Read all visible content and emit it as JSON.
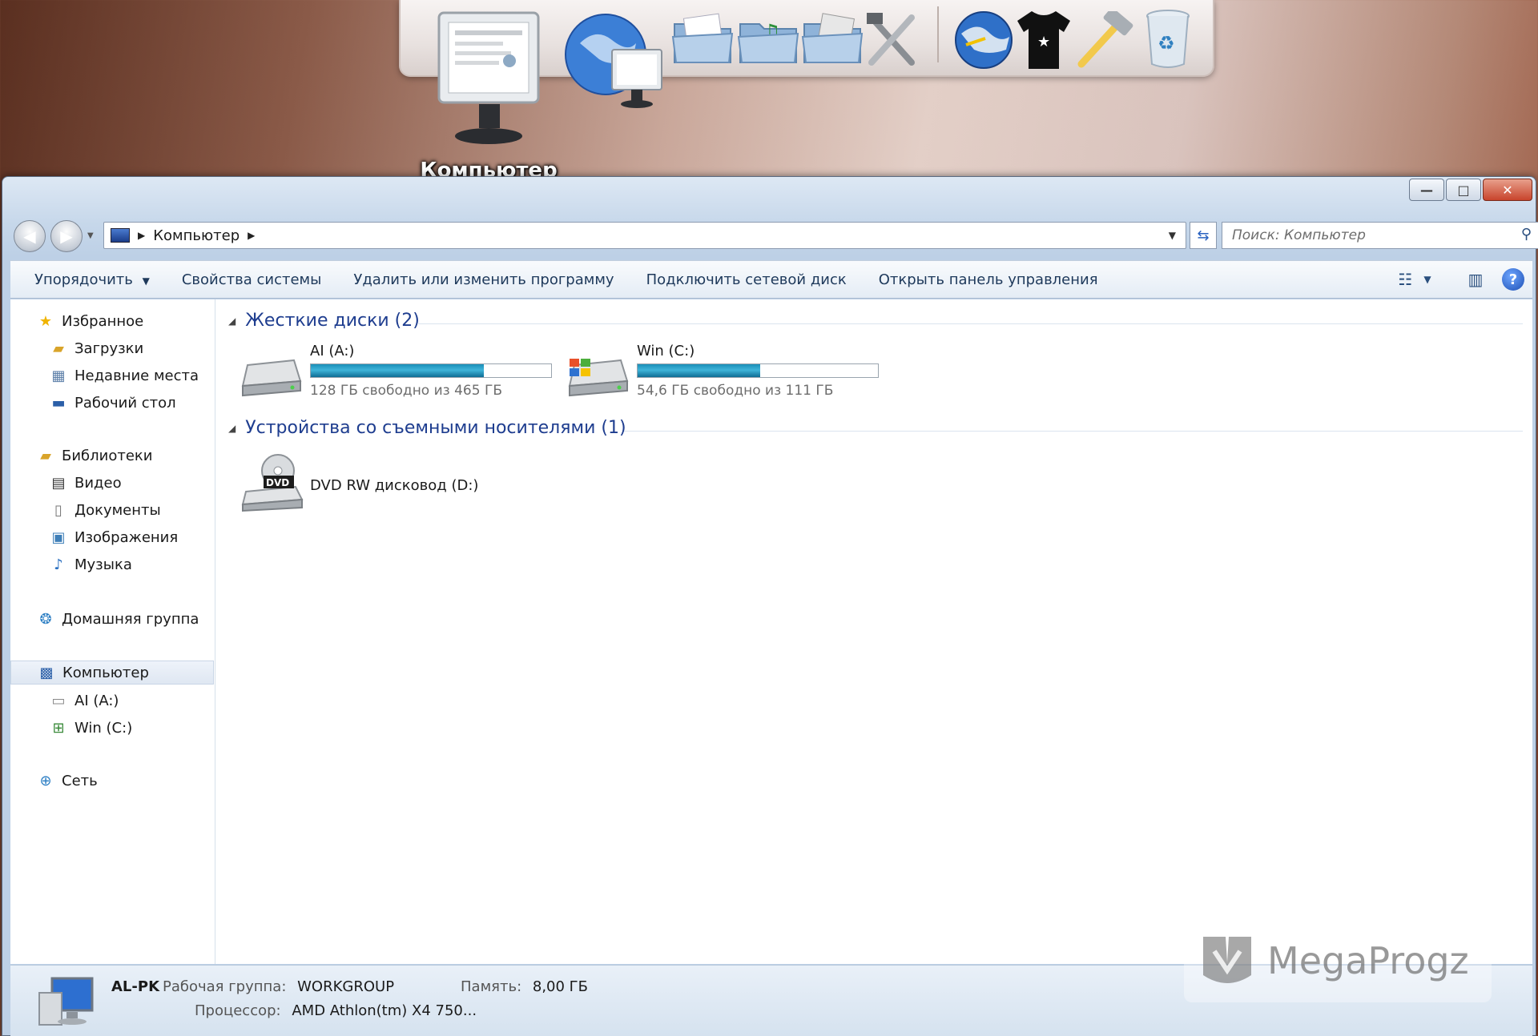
{
  "dock": {
    "hover_label": "Компьютер",
    "icons": [
      "computer-icon",
      "network-globe-icon",
      "documents-folder-icon",
      "music-folder-icon",
      "pictures-folder-icon",
      "tools-icon",
      "globe-icon",
      "tshirt-icon",
      "hammer-icon",
      "recycle-bin-icon"
    ]
  },
  "window": {
    "caption_buttons": {
      "minimize": "—",
      "maximize": "□",
      "close": "✕"
    }
  },
  "nav": {
    "address_path": "Компьютер",
    "search_placeholder": "Поиск: Компьютер"
  },
  "toolbar": {
    "organize": "Упорядочить",
    "system_properties": "Свойства системы",
    "uninstall": "Удалить или изменить программу",
    "map_drive": "Подключить сетевой диск",
    "control_panel": "Открыть панель управления"
  },
  "sidebar": {
    "favorites": {
      "label": "Избранное",
      "items": [
        "Загрузки",
        "Недавние места",
        "Рабочий стол"
      ]
    },
    "libraries": {
      "label": "Библиотеки",
      "items": [
        "Видео",
        "Документы",
        "Изображения",
        "Музыка"
      ]
    },
    "homegroup": "Домашняя группа",
    "computer": {
      "label": "Компьютер",
      "items": [
        "AI (A:)",
        "Win (C:)"
      ]
    },
    "network": "Сеть"
  },
  "content": {
    "hard_disks": {
      "header": "Жесткие диски (2)",
      "drives": [
        {
          "name": "AI (A:)",
          "info": "128 ГБ свободно из 465 ГБ",
          "used_fraction": 0.72
        },
        {
          "name": "Win (C:)",
          "info": "54,6 ГБ свободно из 111 ГБ",
          "used_fraction": 0.51
        }
      ]
    },
    "removable": {
      "header": "Устройства со съемными носителями (1)",
      "drives": [
        {
          "name": "DVD RW дисковод (D:)",
          "icon_text": "DVD"
        }
      ]
    }
  },
  "status": {
    "pc_name": "AL-PK",
    "workgroup_label": "Рабочая группа:",
    "workgroup_value": "WORKGROUP",
    "memory_label": "Память:",
    "memory_value": "8,00 ГБ",
    "cpu_label": "Процессор:",
    "cpu_value": "AMD Athlon(tm) X4 750..."
  },
  "watermark": {
    "text": "MegaProgz"
  },
  "colors": {
    "accent_link": "#1e3d8f",
    "drive_bar": "#1a8eb8",
    "toolbar_text": "#1e395b"
  }
}
